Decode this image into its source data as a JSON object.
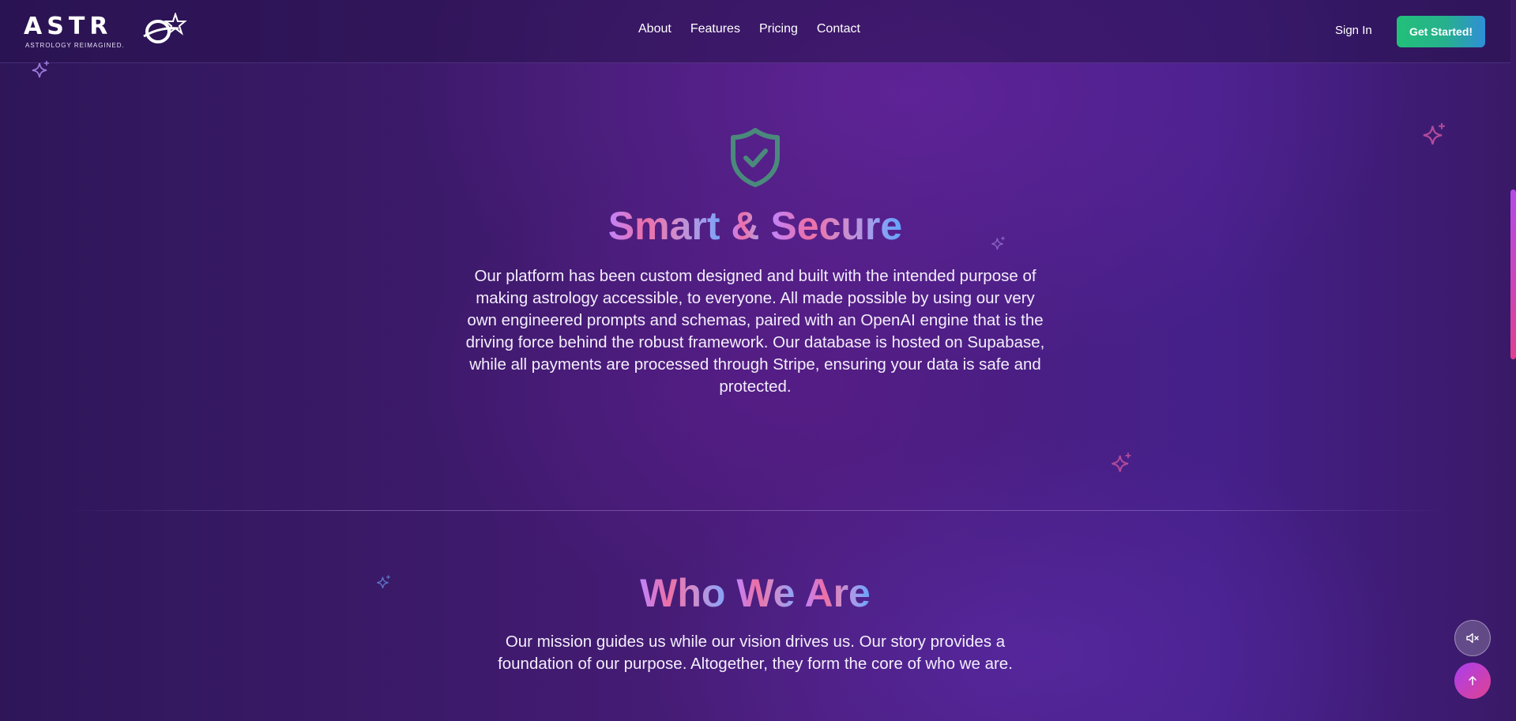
{
  "header": {
    "logo_text": "ASTR",
    "logo_tagline": "ASTROLOGY REIMAGINED.",
    "nav": [
      {
        "label": "About"
      },
      {
        "label": "Features"
      },
      {
        "label": "Pricing"
      },
      {
        "label": "Contact"
      }
    ],
    "sign_in_label": "Sign In",
    "cta_label": "Get Started!"
  },
  "secure_section": {
    "icon": "shield-check-icon",
    "title_parts": [
      "Smart ",
      "& ",
      "Secure"
    ],
    "body": "Our platform has been custom designed and built with the intended purpose of making astrology accessible, to everyone. All made possible by using our very own engineered prompts and schemas, paired with an OpenAI engine that is the driving force behind the robust framework. Our database is hosted on Supabase, while all payments are processed through Stripe, ensuring your data is safe and protected."
  },
  "who_section": {
    "title_parts": [
      "Who ",
      "We ",
      "Are"
    ],
    "body": "Our mission guides us while our vision drives us. Our story provides a foundation of our purpose. Altogether, they form the core of who we are."
  },
  "floating_controls": {
    "mute_icon": "speaker-muted-icon",
    "top_icon": "arrow-up-icon"
  },
  "colors": {
    "cta_gradient_start": "#22c07a",
    "cta_gradient_end": "#2f8fd8",
    "title_gradient_start": "#c084fc",
    "title_gradient_mid": "#ec6fa6",
    "title_gradient_end": "#60a5fa",
    "shield": "#4a8a7c",
    "background": "#3d1a6b"
  }
}
